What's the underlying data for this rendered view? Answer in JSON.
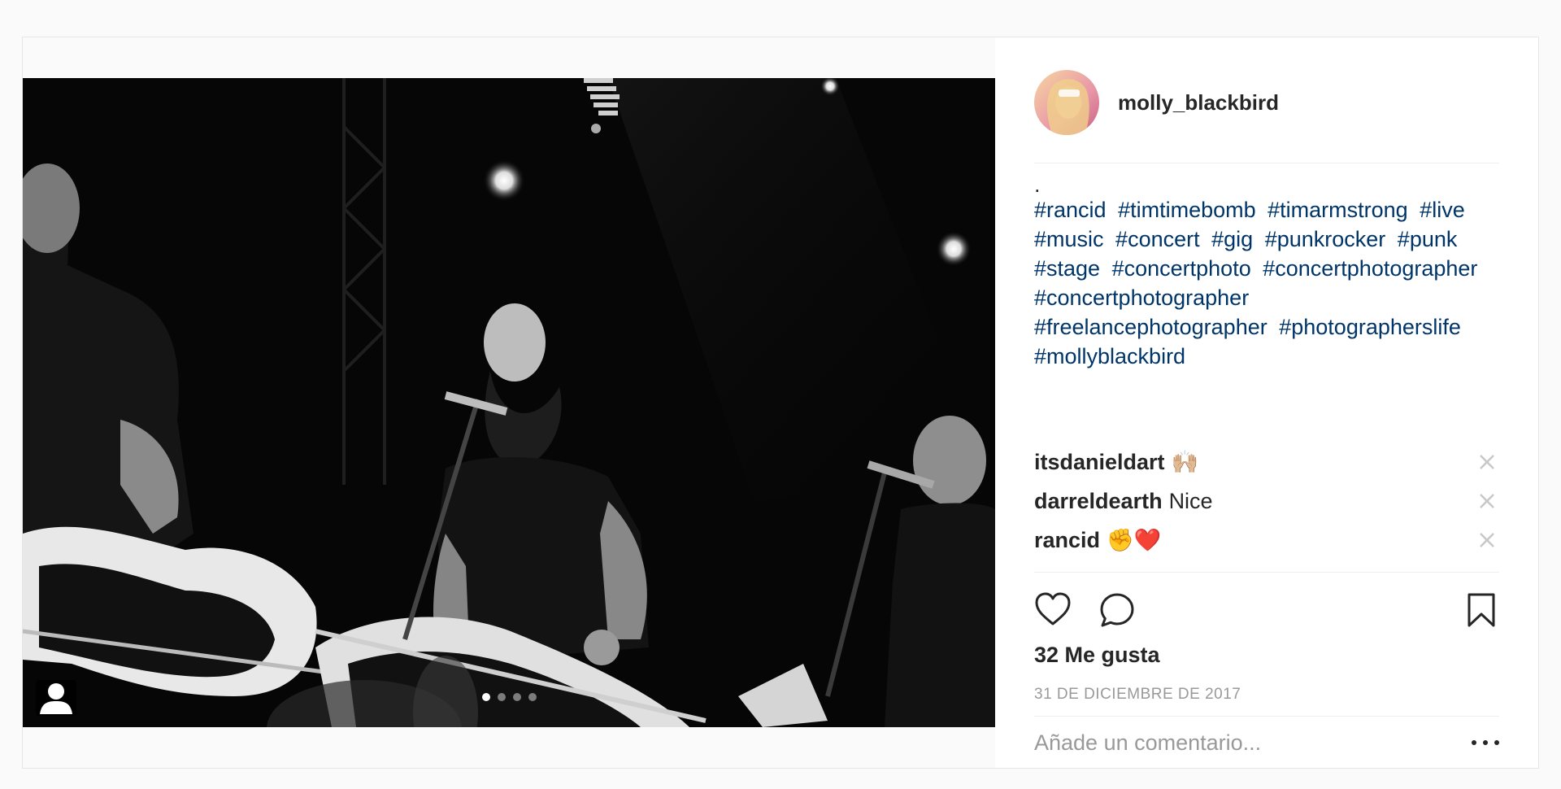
{
  "post": {
    "author": {
      "username": "molly_blackbird"
    },
    "caption": {
      "first_line": ".",
      "hashtags": [
        "#rancid",
        "#timtimebomb",
        "#timarmstrong",
        "#live",
        "#music",
        "#concert",
        "#gig",
        "#punkrocker",
        "#punk",
        "#stage",
        "#concertphoto",
        "#concertphotographer",
        "#concertphotographer",
        "#freelancephotographer",
        "#photographerslife",
        "#mollyblackbird"
      ]
    },
    "comments": [
      {
        "author": "itsdanieldart",
        "text": "🙌🏼"
      },
      {
        "author": "darreldearth",
        "text": "Nice"
      },
      {
        "author": "rancid",
        "text": "✊❤️"
      }
    ],
    "likes_label": "32 Me gusta",
    "date_label": "31 DE DICIEMBRE DE 2017",
    "add_comment_placeholder": "Añade un comentario...",
    "carousel": {
      "total_slides": 4,
      "current_slide": 1
    },
    "icons": {
      "tag": "user-tag-icon",
      "like": "heart-icon",
      "comment": "comment-bubble-icon",
      "save": "bookmark-icon",
      "delete_comment": "close-icon",
      "options": "more-options-icon"
    },
    "colors": {
      "hashtag": "#003569",
      "text": "#262626",
      "muted": "#999999",
      "border": "#efefef",
      "background": "#fafafa"
    }
  }
}
